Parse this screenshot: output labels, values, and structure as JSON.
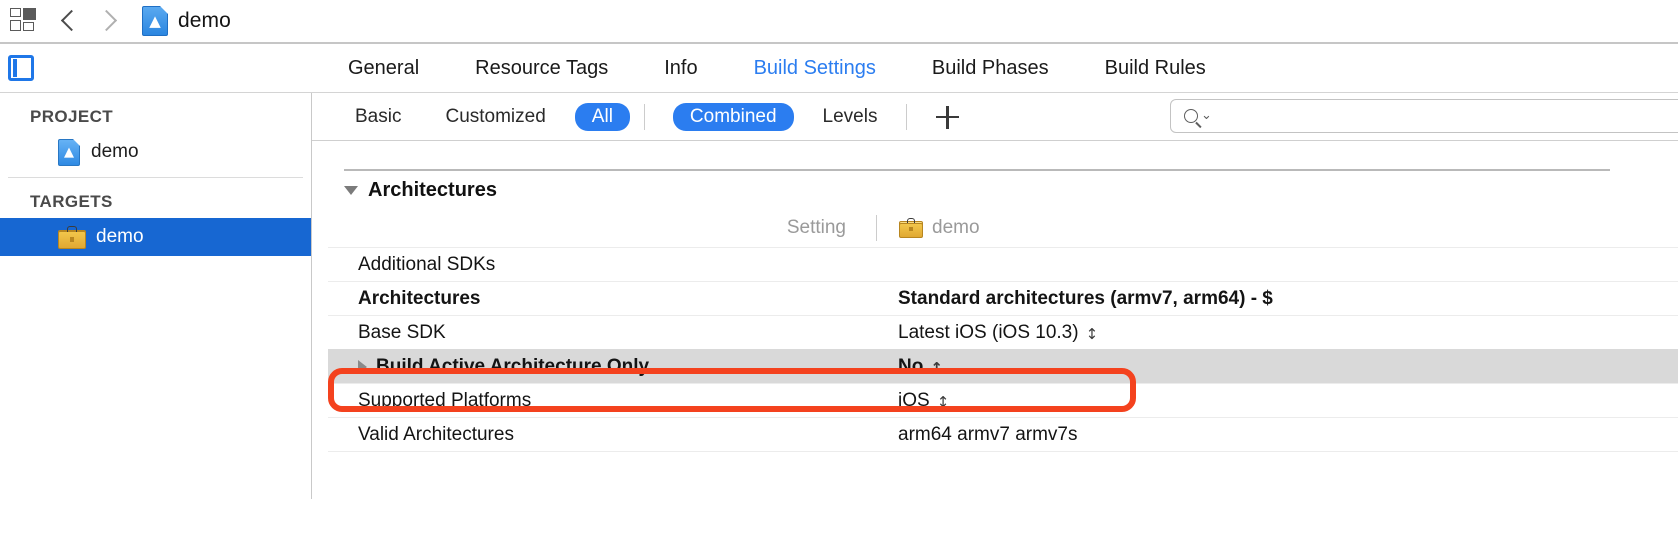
{
  "toolbar": {
    "grid_icon": "grid-icon",
    "back_label": "back",
    "forward_label": "forward",
    "breadcrumb": "demo",
    "project_icon": "xcode-project-icon"
  },
  "tabbar": {
    "toggle_icon": "navigator-toggle-icon",
    "tabs": [
      {
        "label": "General",
        "active": false
      },
      {
        "label": "Resource Tags",
        "active": false
      },
      {
        "label": "Info",
        "active": false
      },
      {
        "label": "Build Settings",
        "active": true
      },
      {
        "label": "Build Phases",
        "active": false
      },
      {
        "label": "Build Rules",
        "active": false
      }
    ],
    "active_color": "#2b7df0"
  },
  "sidebar": {
    "project_header": "PROJECT",
    "project_items": [
      {
        "label": "demo",
        "icon": "project-document-icon"
      }
    ],
    "targets_header": "TARGETS",
    "target_items": [
      {
        "label": "demo",
        "icon": "toolbox-icon",
        "selected": true
      }
    ],
    "selection_color": "#1767d2"
  },
  "filterbar": {
    "scopes": [
      {
        "label": "Basic",
        "on": false
      },
      {
        "label": "Customized",
        "on": false
      },
      {
        "label": "All",
        "on": true
      }
    ],
    "modes": [
      {
        "label": "Combined",
        "on": true
      },
      {
        "label": "Levels",
        "on": false
      }
    ],
    "add_label": "+",
    "add_icon": "plus-icon",
    "pill_color": "#2b7df0"
  },
  "search": {
    "icon": "search-icon",
    "chevron": "⌄",
    "value": "",
    "placeholder": ""
  },
  "settings": {
    "group": "Architectures",
    "columns": {
      "setting": "Setting",
      "target": "demo",
      "target_icon": "toolbox-icon"
    },
    "rows": [
      {
        "name": "Additional SDKs",
        "value": "",
        "bold": false,
        "stepper": false,
        "expandable": false,
        "highlighted": false
      },
      {
        "name": "Architectures",
        "value": "Standard architectures (armv7, arm64)  -  $",
        "bold": true,
        "stepper": false,
        "expandable": false,
        "highlighted": false
      },
      {
        "name": "Base SDK",
        "value": "Latest iOS (iOS 10.3)",
        "bold": false,
        "stepper": true,
        "expandable": false,
        "highlighted": false
      },
      {
        "name": "Build Active Architecture Only",
        "value": "No",
        "bold": true,
        "stepper": true,
        "expandable": true,
        "highlighted": true
      },
      {
        "name": "Supported Platforms",
        "value": "iOS",
        "bold": false,
        "stepper": true,
        "expandable": false,
        "highlighted": false
      },
      {
        "name": "Valid Architectures",
        "value": "arm64 armv7 armv7s",
        "bold": false,
        "stepper": false,
        "expandable": false,
        "highlighted": false
      }
    ],
    "stepper_glyph": "⌃⌄",
    "highlight_row_color": "#d9d9d9"
  },
  "annotation": {
    "color": "#f4421e",
    "shape": "rounded-rectangle",
    "target": "Build Active Architecture Only"
  }
}
